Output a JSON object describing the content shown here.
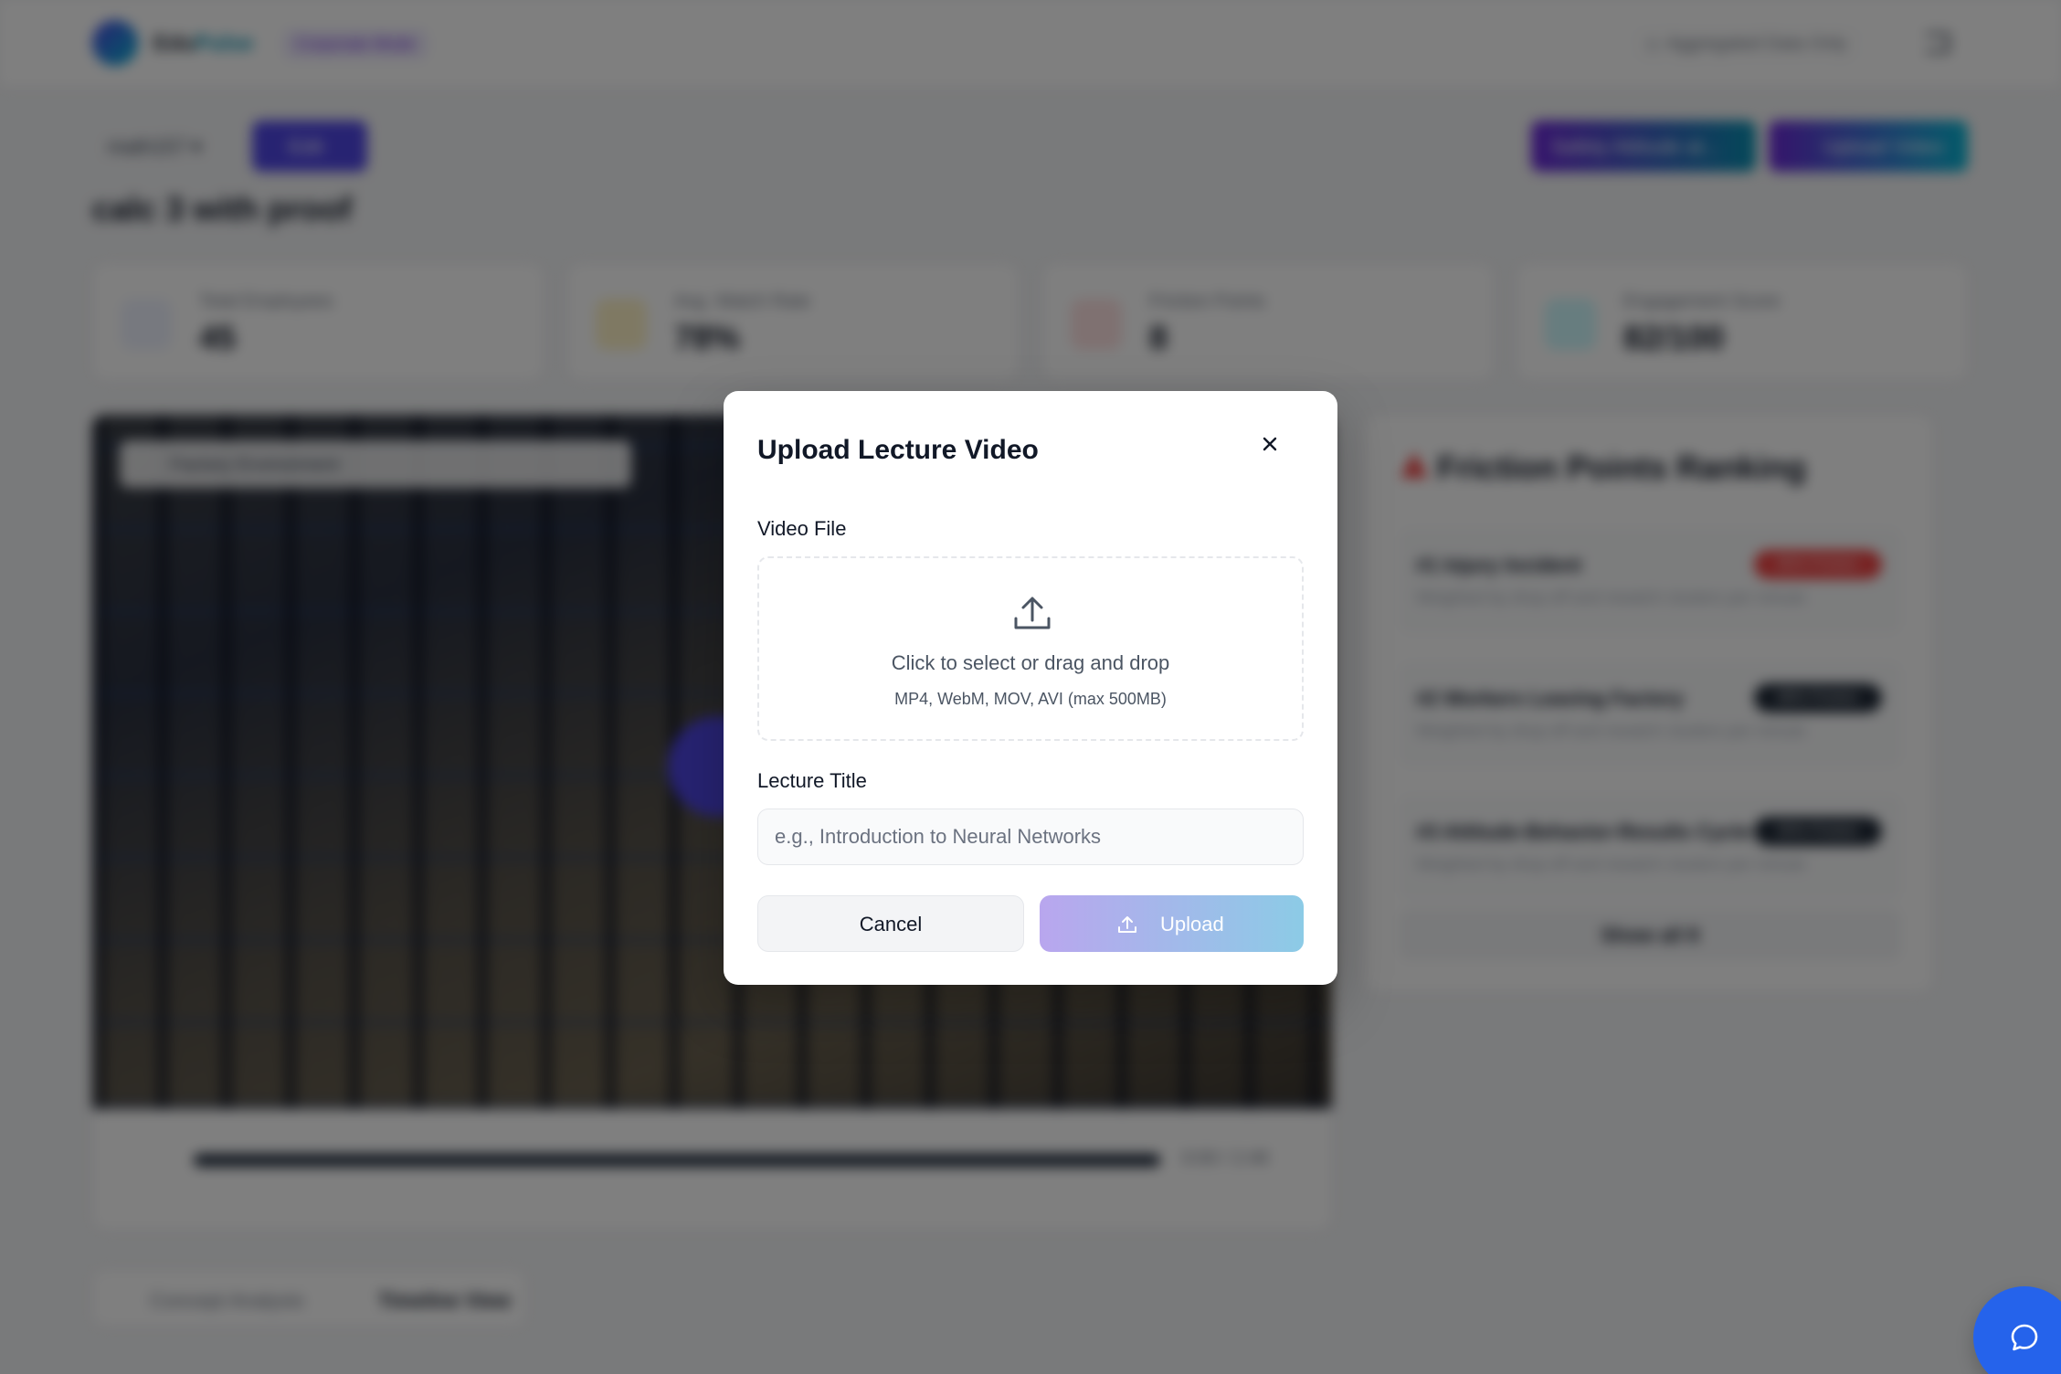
{
  "app": {
    "brand_part1": "Edu",
    "brand_part2": "Pulse",
    "mode_badge": "Corporate Mode",
    "sync_label": "Aggregated Data Only",
    "course_select": "math157",
    "edit_label": "Edit",
    "header_btn_1": "Safety Attitude at...",
    "header_btn_2": "Upload Video",
    "page_title": "calc 3 with proof"
  },
  "stats": [
    {
      "label": "Total Employees",
      "value": "45",
      "icon": "users-icon",
      "color": "#6366f1"
    },
    {
      "label": "Avg. Watch Rate",
      "value": "78%",
      "icon": "sun-icon",
      "color": "#f59e0b"
    },
    {
      "label": "Friction Points",
      "value": "8",
      "icon": "alert-icon",
      "color": "#ef4444"
    },
    {
      "label": "Engagement Score",
      "value": "82/100",
      "icon": "trend-icon",
      "color": "#06b6d4"
    }
  ],
  "video": {
    "env_label": "Factory Environment",
    "time": "0:00 / 2:48"
  },
  "ranking": {
    "title": "Friction Points Ranking",
    "items": [
      {
        "name": "#1 Injury Incident",
        "sub": "Weighted by drop-off and rewatch clusters per minute",
        "badge": "85% Friction",
        "badge_color": "#ef4444"
      },
      {
        "name": "#2 Workers Leaving Factory",
        "sub": "Weighted by drop-off and rewatch clusters per minute",
        "badge": "68% Friction",
        "badge_color": "#1f2937"
      },
      {
        "name": "#3 Attitude-Behavior-Results Cycle",
        "sub": "Weighted by drop-off and rewatch clusters per minute",
        "badge": "55% Friction",
        "badge_color": "#1f2937"
      }
    ],
    "show_all": "Show all 8"
  },
  "tabs": {
    "concept": "Concept Analysis",
    "timeline": "Timeline View"
  },
  "modal": {
    "title": "Upload Lecture Video",
    "video_file_label": "Video File",
    "dropzone_main": "Click to select or drag and drop",
    "dropzone_sub": "MP4, WebM, MOV, AVI (max 500MB)",
    "lecture_title_label": "Lecture Title",
    "lecture_title_placeholder": "e.g., Introduction to Neural Networks",
    "lecture_title_value": "",
    "cancel_label": "Cancel",
    "upload_label": "Upload"
  },
  "colors": {
    "primary": "#4f46e5",
    "accent": "#06b6d4",
    "chat_fab": "#2563eb"
  }
}
